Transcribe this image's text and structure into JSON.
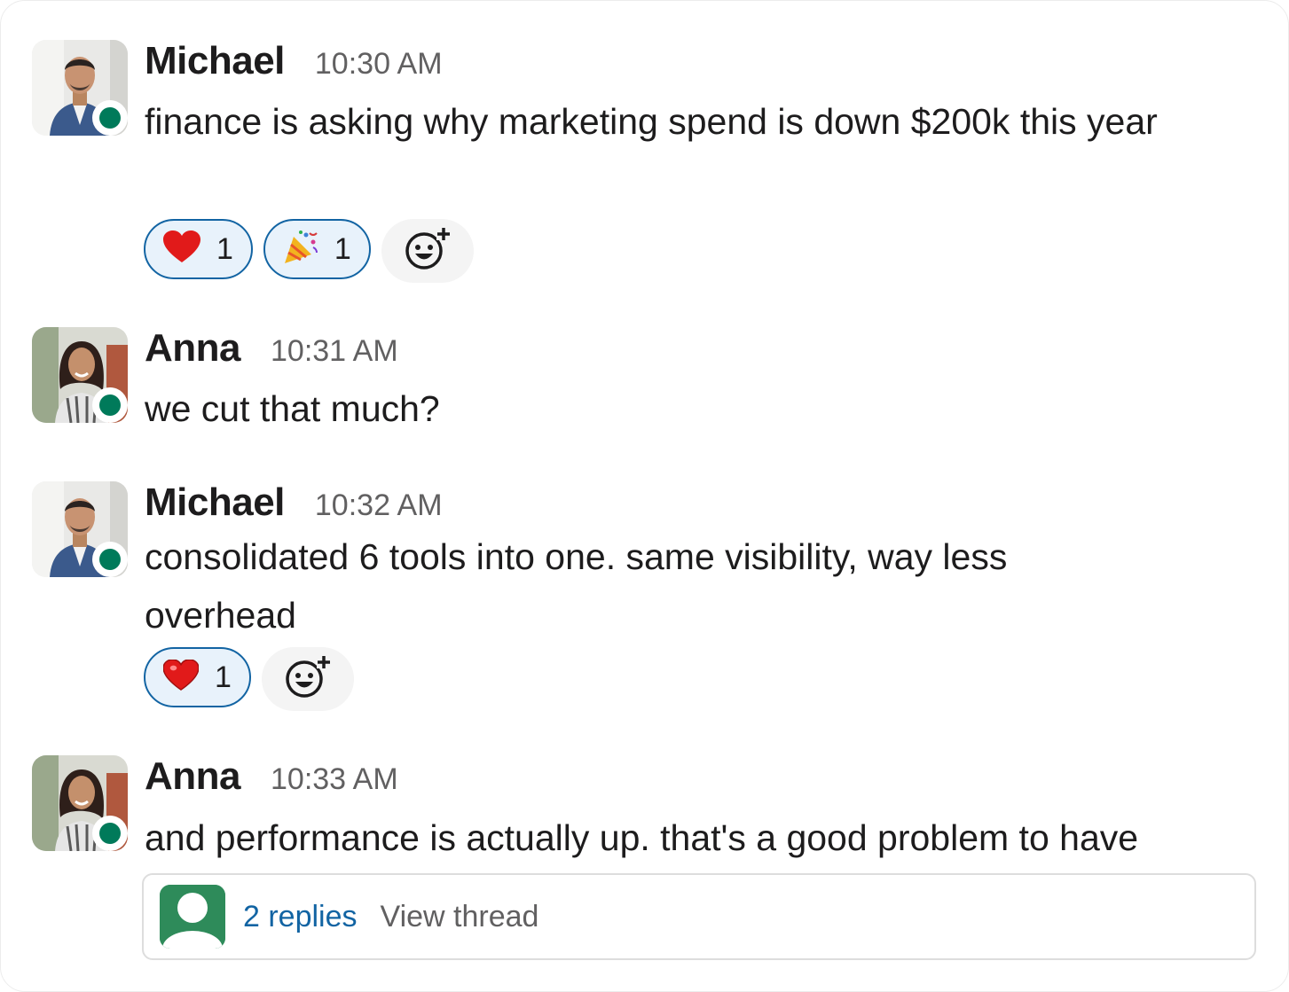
{
  "messages": [
    {
      "sender": "Michael",
      "time": "10:30 AM",
      "text": "finance is asking why marketing spend is down $200k this year",
      "avatar": "michael-avatar",
      "reactions": [
        {
          "emoji": "heart",
          "count": "1"
        },
        {
          "emoji": "party-popper",
          "count": "1"
        }
      ]
    },
    {
      "sender": "Anna",
      "time": "10:31 AM",
      "text": "we cut that much?",
      "avatar": "anna-avatar"
    },
    {
      "sender": "Michael",
      "time": "10:32 AM",
      "text": "consolidated 6 tools into one. same visibility, way less overhead",
      "avatar": "michael-avatar",
      "reactions": [
        {
          "emoji": "heart",
          "count": "1"
        }
      ]
    },
    {
      "sender": "Anna",
      "time": "10:33 AM",
      "text": "and performance is actually up. that's a good problem to have",
      "avatar": "anna-avatar"
    }
  ],
  "thread": {
    "replies_label": "2 replies",
    "view_label": "View thread"
  },
  "colors": {
    "presence": "#007a5a",
    "reaction_border": "#1264a3",
    "reaction_bg": "#e8f2fb",
    "link": "#1264a3"
  }
}
